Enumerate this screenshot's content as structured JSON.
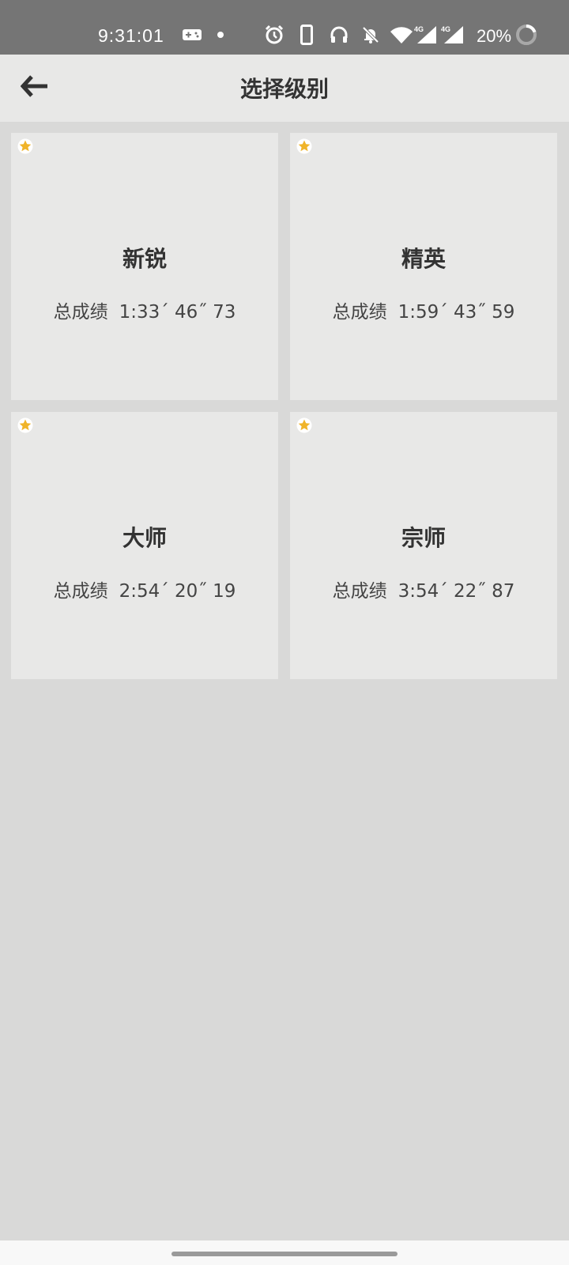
{
  "status_bar": {
    "time": "9:31:01",
    "battery": "20%",
    "icons": [
      "gamepad-icon",
      "dot-icon",
      "alarm-icon",
      "phone-icon",
      "headset-icon",
      "bell-off-icon",
      "wifi-icon",
      "signal-4g-icon",
      "signal-4g-icon",
      "battery-ring-icon"
    ],
    "network_label": "4G"
  },
  "header": {
    "title": "选择级别",
    "back_icon": "arrow-left-icon"
  },
  "levels": [
    {
      "name": "新锐",
      "score_label": "总成绩",
      "score": "1:33´ 46˝ 73",
      "starred": true
    },
    {
      "name": "精英",
      "score_label": "总成绩",
      "score": "1:59´ 43˝ 59",
      "starred": true
    },
    {
      "name": "大师",
      "score_label": "总成绩",
      "score": "2:54´ 20˝ 19",
      "starred": true
    },
    {
      "name": "宗师",
      "score_label": "总成绩",
      "score": "3:54´ 22˝ 87",
      "starred": true
    }
  ],
  "colors": {
    "status_bar": "#757575",
    "app_bar": "#e8e8e7",
    "background": "#d9d9d8",
    "card": "#e8e8e7",
    "star": "#f0b429"
  }
}
